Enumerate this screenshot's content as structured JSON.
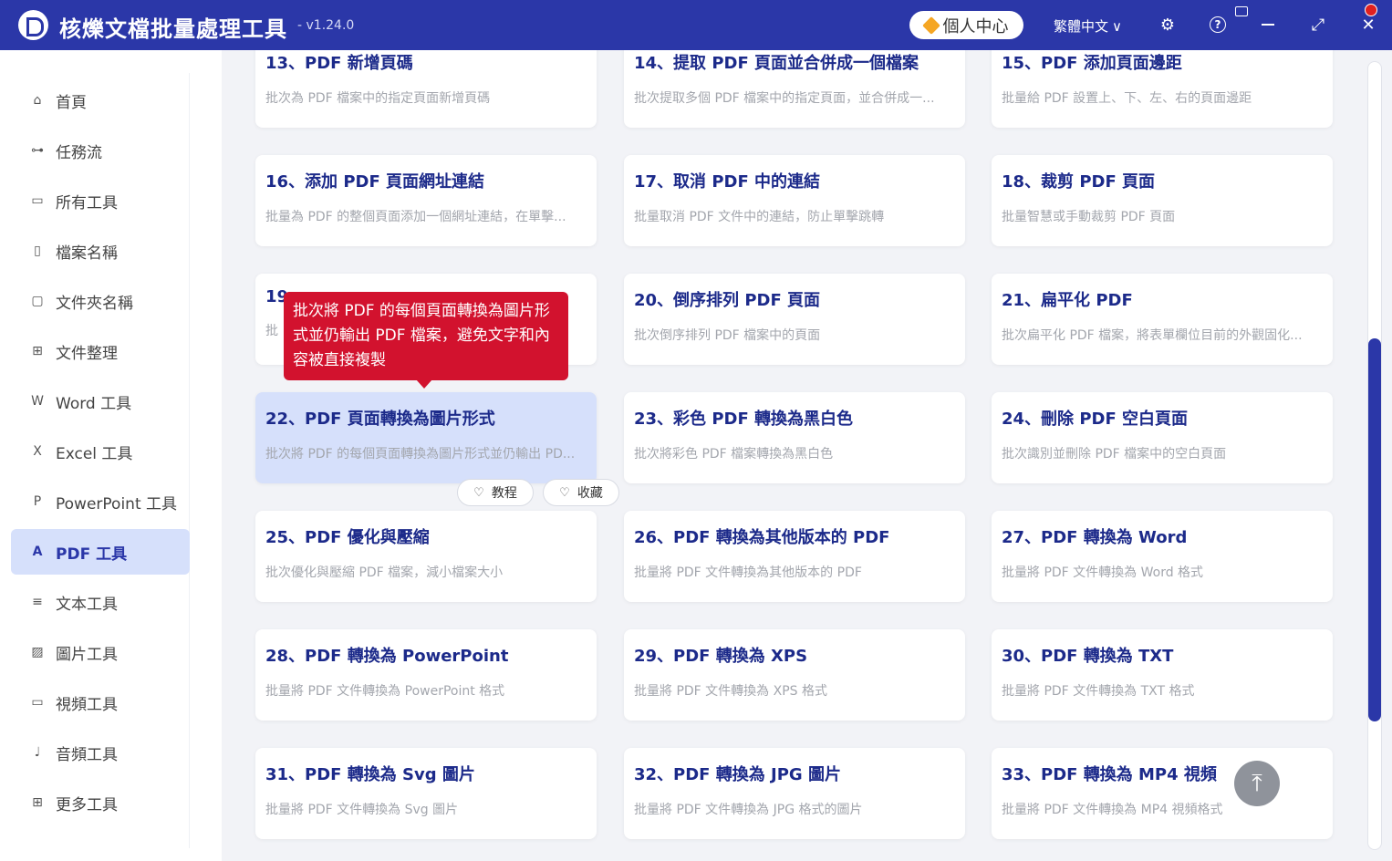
{
  "titlebar": {
    "title": "核爍文檔批量處理工具",
    "version": "- v1.24.0",
    "user_center": "個人中心",
    "language": "繁體中文",
    "language_chevron": "∨",
    "settings_icon": "⚙",
    "help_icon": "?",
    "maximize_icon": "⤢",
    "close_icon": "✕"
  },
  "sidebar": {
    "items": [
      {
        "label": "首頁",
        "icon": "⌂"
      },
      {
        "label": "任務流",
        "icon": "⊶"
      },
      {
        "label": "所有工具",
        "icon": "▭"
      },
      {
        "label": "檔案名稱",
        "icon": "▯"
      },
      {
        "label": "文件夾名稱",
        "icon": "▢"
      },
      {
        "label": "文件整理",
        "icon": "⊞"
      },
      {
        "label": "Word 工具",
        "icon": "W"
      },
      {
        "label": "Excel 工具",
        "icon": "X"
      },
      {
        "label": "PowerPoint 工具",
        "icon": "P"
      },
      {
        "label": "PDF 工具",
        "icon": "A"
      },
      {
        "label": "文本工具",
        "icon": "≡"
      },
      {
        "label": "圖片工具",
        "icon": "▨"
      },
      {
        "label": "視頻工具",
        "icon": "▭"
      },
      {
        "label": "音頻工具",
        "icon": "♩"
      },
      {
        "label": "更多工具",
        "icon": "⊞"
      }
    ],
    "active_index": 9
  },
  "cards": [
    {
      "title": "13、PDF 新增頁碼",
      "desc": "批次為 PDF 檔案中的指定頁面新增頁碼"
    },
    {
      "title": "14、提取 PDF 頁面並合併成一個檔案",
      "desc": "批次提取多個 PDF 檔案中的指定頁面，並合併成一..."
    },
    {
      "title": "15、PDF 添加頁面邊距",
      "desc": "批量給 PDF 設置上、下、左、右的頁面邊距"
    },
    {
      "title": "16、添加 PDF 頁面網址連結",
      "desc": "批量為 PDF 的整個頁面添加一個網址連結，在單擊..."
    },
    {
      "title": "17、取消 PDF 中的連結",
      "desc": "批量取消 PDF 文件中的連結，防止單擊跳轉"
    },
    {
      "title": "18、裁剪 PDF 頁面",
      "desc": "批量智慧或手動裁剪 PDF 頁面"
    },
    {
      "title": "19",
      "desc": "批"
    },
    {
      "title": "20、倒序排列 PDF 頁面",
      "desc": "批次倒序排列 PDF 檔案中的頁面"
    },
    {
      "title": "21、扁平化 PDF",
      "desc": "批次扁平化 PDF 檔案，將表單欄位目前的外觀固化..."
    },
    {
      "title": "22、PDF 頁面轉換為圖片形式",
      "desc": "批次將 PDF 的每個頁面轉換為圖片形式並仍輸出 PD..."
    },
    {
      "title": "23、彩色 PDF 轉換為黑白色",
      "desc": "批次將彩色 PDF 檔案轉換為黑白色"
    },
    {
      "title": "24、刪除 PDF 空白頁面",
      "desc": "批次識別並刪除 PDF 檔案中的空白頁面"
    },
    {
      "title": "25、PDF 優化與壓縮",
      "desc": "批次優化與壓縮 PDF 檔案，減小檔案大小"
    },
    {
      "title": "26、PDF 轉換為其他版本的 PDF",
      "desc": "批量將 PDF 文件轉換為其他版本的 PDF"
    },
    {
      "title": "27、PDF 轉換為 Word",
      "desc": "批量將 PDF 文件轉換為 Word 格式"
    },
    {
      "title": "28、PDF 轉換為 PowerPoint",
      "desc": "批量將 PDF 文件轉換為 PowerPoint 格式"
    },
    {
      "title": "29、PDF 轉換為 XPS",
      "desc": "批量將 PDF 文件轉換為 XPS 格式"
    },
    {
      "title": "30、PDF 轉換為 TXT",
      "desc": "批量將 PDF 文件轉換為 TXT 格式"
    },
    {
      "title": "31、PDF 轉換為 Svg 圖片",
      "desc": "批量將 PDF 文件轉換為 Svg 圖片"
    },
    {
      "title": "32、PDF 轉換為 JPG 圖片",
      "desc": "批量將 PDF 文件轉換為 JPG 格式的圖片"
    },
    {
      "title": "33、PDF 轉換為 MP4 視頻",
      "desc": "批量將 PDF 文件轉換為 MP4 視頻格式"
    }
  ],
  "tooltip": {
    "text": "批次將 PDF 的每個頁面轉換為圖片形式並仍輸出 PDF 檔案，避免文字和內容被直接複製"
  },
  "card_actions": {
    "tutorial": "教程",
    "tutorial_icon": "♡",
    "favorite": "收藏",
    "favorite_icon": "♡"
  },
  "scroll_top_icon": "⤒",
  "colors": {
    "brand": "#2b37a8",
    "card_title": "#1c2a8a",
    "highlight": "#d6e0fb",
    "tooltip": "#d2122e"
  }
}
